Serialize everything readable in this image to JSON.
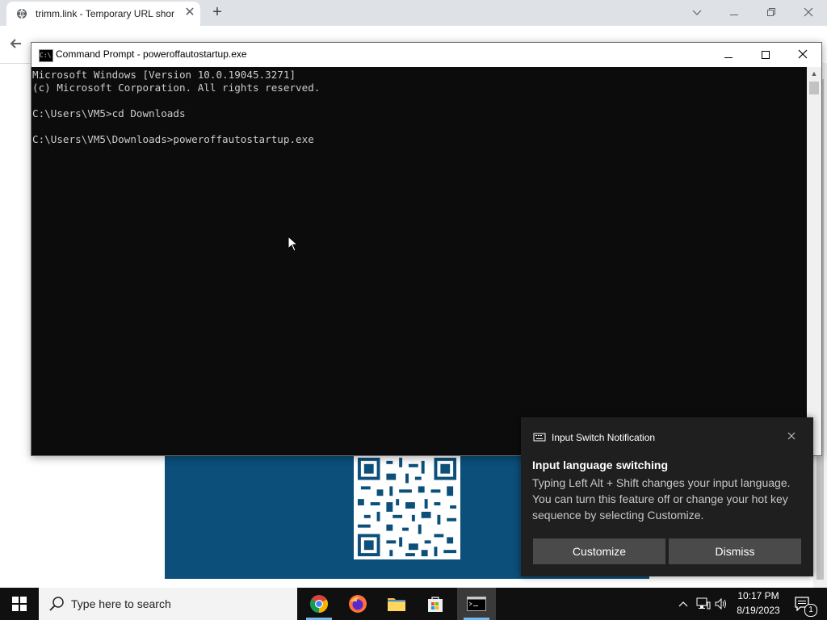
{
  "browser": {
    "tab_title": "trimm.link - Temporary URL shor",
    "tab_close": "✕",
    "new_tab": "+"
  },
  "cmd": {
    "title": "Command Prompt - poweroffautostartup.exe",
    "lines": [
      "Microsoft Windows [Version 10.0.19045.3271]",
      "(c) Microsoft Corporation. All rights reserved.",
      "",
      "C:\\Users\\VM5>cd Downloads",
      "",
      "C:\\Users\\VM5\\Downloads>poweroffautostartup.exe"
    ]
  },
  "notification": {
    "app_name": "Input Switch Notification",
    "heading": "Input language switching",
    "body": "Typing Left Alt + Shift changes your input language. You can turn this feature off or change your hot key sequence by selecting Customize.",
    "customize_label": "Customize",
    "dismiss_label": "Dismiss"
  },
  "taskbar": {
    "search_placeholder": "Type here to search",
    "time": "10:17 PM",
    "date": "8/19/2023",
    "notification_count": "1"
  },
  "colors": {
    "console_bg": "#0c0c0c",
    "console_text": "#cccccc",
    "notification_bg": "#1f1f1f",
    "taskbar_bg": "#101010",
    "page_banner": "#0b4f7a"
  }
}
